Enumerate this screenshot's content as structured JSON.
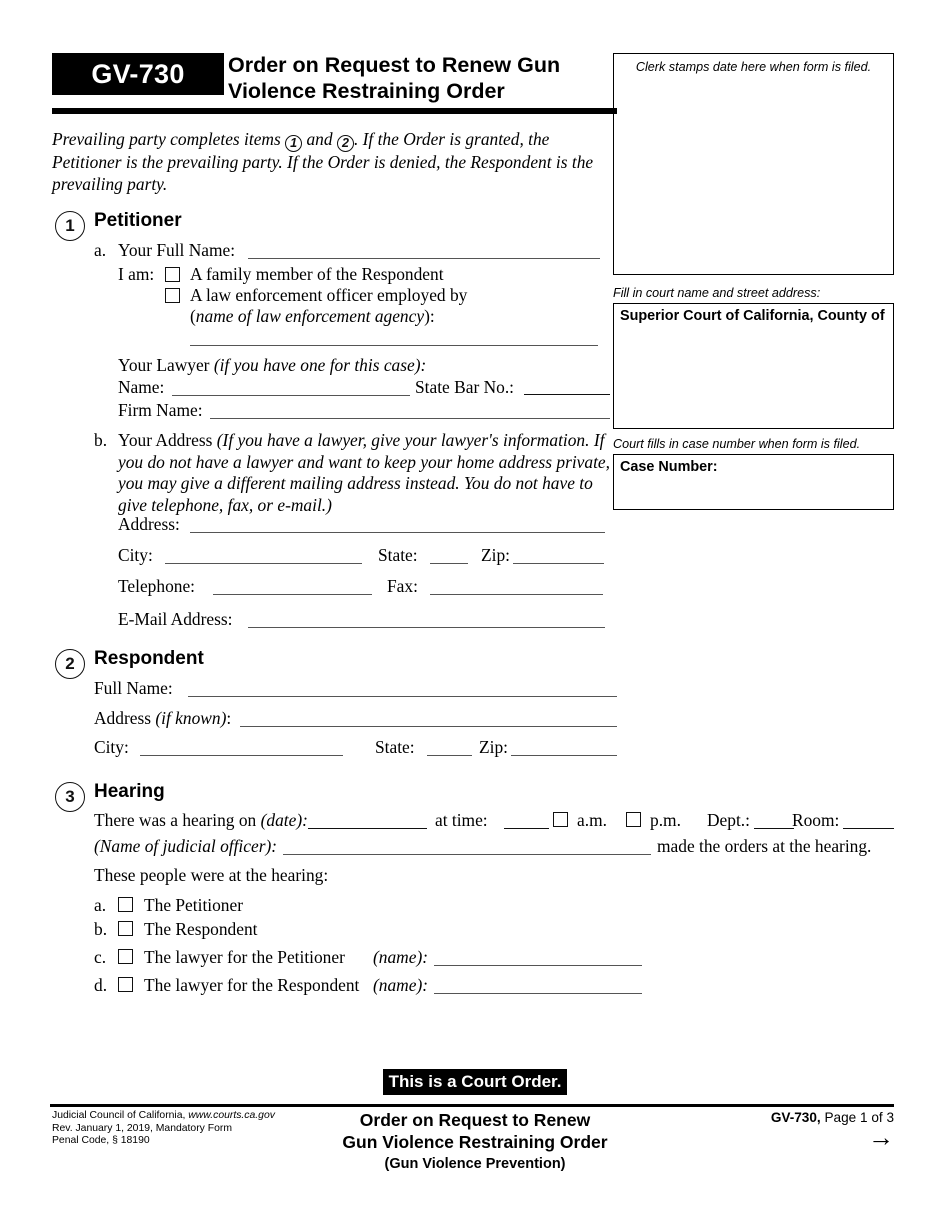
{
  "form": {
    "code": "GV-730",
    "title_line1": "Order on Request to Renew Gun",
    "title_line2": "Violence Restraining Order",
    "intro_part1": "Prevailing party completes items",
    "intro_num1": "1",
    "intro_and": "and",
    "intro_num2": "2",
    "intro_part2": ". If the Order is granted, the Petitioner is the prevailing party. If the Order is denied, the Respondent is the prevailing party."
  },
  "right_column": {
    "clerk_caption": "Clerk stamps date here when form is filed.",
    "court_caption": "Fill in court name and street address:",
    "court_label": "Superior Court of California, County of",
    "case_caption": "Court fills in case number when form is filed.",
    "case_label": "Case Number:"
  },
  "section1": {
    "number": "1",
    "heading": "Petitioner",
    "a_letter": "a.",
    "full_name_label": "Your Full Name:",
    "i_am_label": "I am:",
    "choice1": "A family member of the Respondent",
    "choice2": "A law enforcement officer employed by",
    "choice2_hint_open": "(",
    "choice2_hint": "name of law enforcement agency",
    "choice2_hint_close": "):",
    "lawyer_label": "Your Lawyer",
    "lawyer_hint": "(if you have one for this case):",
    "name_label": "Name:",
    "state_bar_label": "State Bar No.:",
    "firm_name_label": "Firm Name:",
    "b_letter": "b.",
    "address_heading": "Your Address",
    "address_hint": "(If you have a lawyer, give your lawyer's information. If you do not have a lawyer and want to keep your home address private, you may give a different mailing address instead. You do not have to give telephone, fax, or e-mail.)",
    "address_label": "Address:",
    "city_label": "City:",
    "state_label": "State:",
    "zip_label": "Zip:",
    "telephone_label": "Telephone:",
    "fax_label": "Fax:",
    "email_label": "E-Mail Address:"
  },
  "section2": {
    "number": "2",
    "heading": "Respondent",
    "full_name_label": "Full Name:",
    "address_label": "Address",
    "address_hint": "(if known)",
    "address_colon": ":",
    "city_label": "City:",
    "state_label": "State:",
    "zip_label": "Zip:"
  },
  "section3": {
    "number": "3",
    "heading": "Hearing",
    "hearing_lead": "There was a hearing on",
    "hearing_date_hint": "(date):",
    "at_time_label": "at time:",
    "am_label": "a.m.",
    "pm_label": "p.m.",
    "dept_label": "Dept.:",
    "room_label": "Room:",
    "judicial_officer_hint": "(Name of judicial officer):",
    "made_orders": "made the orders at the hearing.",
    "attendees_lead": "These people were at the hearing:",
    "attendees": [
      {
        "letter": "a.",
        "label": "The Petitioner",
        "name_hint": ""
      },
      {
        "letter": "b.",
        "label": "The Respondent",
        "name_hint": ""
      },
      {
        "letter": "c.",
        "label": "The lawyer for the Petitioner",
        "name_hint": "(name):"
      },
      {
        "letter": "d.",
        "label": "The lawyer for the Respondent",
        "name_hint": "(name):"
      }
    ]
  },
  "footer": {
    "court_order_banner": "This is a Court Order.",
    "left_line1_plain": "Judicial Council of California, ",
    "left_line1_italic": "www.courts.ca.gov",
    "left_line2": "Rev. January 1, 2019, Mandatory Form",
    "left_line3": "Penal Code, § 18190",
    "center_line1": "Order on Request to Renew",
    "center_line2": "Gun Violence Restraining Order",
    "center_line3": "(Gun Violence Prevention)",
    "right_code": "GV-730,",
    "right_page": " Page 1 of 3",
    "arrow": "→"
  }
}
